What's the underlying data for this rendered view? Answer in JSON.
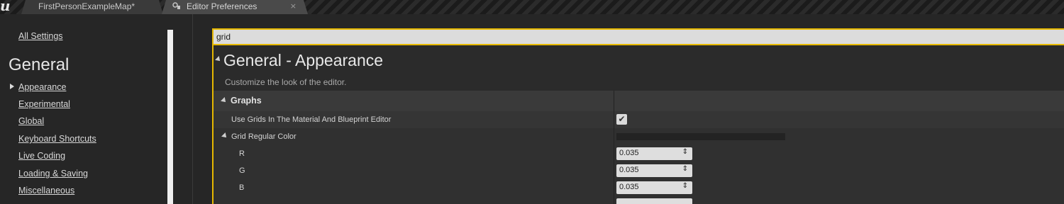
{
  "tabs": [
    {
      "label": "FirstPersonExampleMap*"
    },
    {
      "label": "Editor Preferences",
      "close": "×"
    }
  ],
  "logo_text": "u",
  "sidebar": {
    "all_settings": "All Settings",
    "category": "General",
    "items": [
      {
        "label": "Appearance",
        "selected": true
      },
      {
        "label": "Experimental"
      },
      {
        "label": "Global"
      },
      {
        "label": "Keyboard Shortcuts"
      },
      {
        "label": "Live Coding"
      },
      {
        "label": "Loading & Saving"
      },
      {
        "label": "Miscellaneous"
      }
    ]
  },
  "search": {
    "value": "grid"
  },
  "section": {
    "title": "General - Appearance",
    "description": "Customize the look of the editor."
  },
  "properties": {
    "group": "Graphs",
    "use_grids_label": "Use Grids In The Material And Blueprint Editor",
    "use_grids_checked": true,
    "check_glyph": "✔",
    "grid_regular_color_label": "Grid Regular Color",
    "channels": [
      {
        "label": "R",
        "value": "0.035"
      },
      {
        "label": "G",
        "value": "0.035"
      },
      {
        "label": "B",
        "value": "0.035"
      }
    ],
    "spin_glyph": "⇕"
  },
  "colors": {
    "accent_outline": "#e6b800",
    "background": "#262626"
  },
  "icons": [
    "unreal-logo-icon",
    "level-tab-icon",
    "preferences-tab-icon",
    "close-icon",
    "collapse-arrow-icon",
    "checkmark-icon",
    "spinner-icon"
  ]
}
